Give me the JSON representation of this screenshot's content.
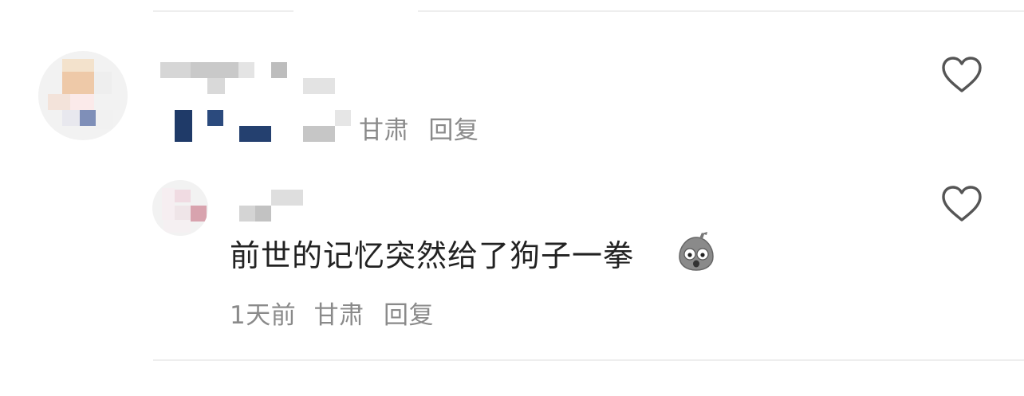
{
  "comments": [
    {
      "author": "",
      "text": "",
      "meta": {
        "time": "",
        "location": "甘肃",
        "reply_label": "回复"
      },
      "liked": false
    },
    {
      "author": "",
      "text": "前世的记忆突然给了狗子一拳",
      "meta": {
        "time": "1天前",
        "location": "甘肃",
        "reply_label": "回复"
      },
      "liked": false
    }
  ],
  "icons": {
    "like": "heart-outline-icon",
    "emoji": "surprised-stone-face-emoji"
  },
  "colors": {
    "text_primary": "#222222",
    "text_meta": "#8a8a8a",
    "heart_stroke": "#555555",
    "divider": "#eeeeee"
  }
}
